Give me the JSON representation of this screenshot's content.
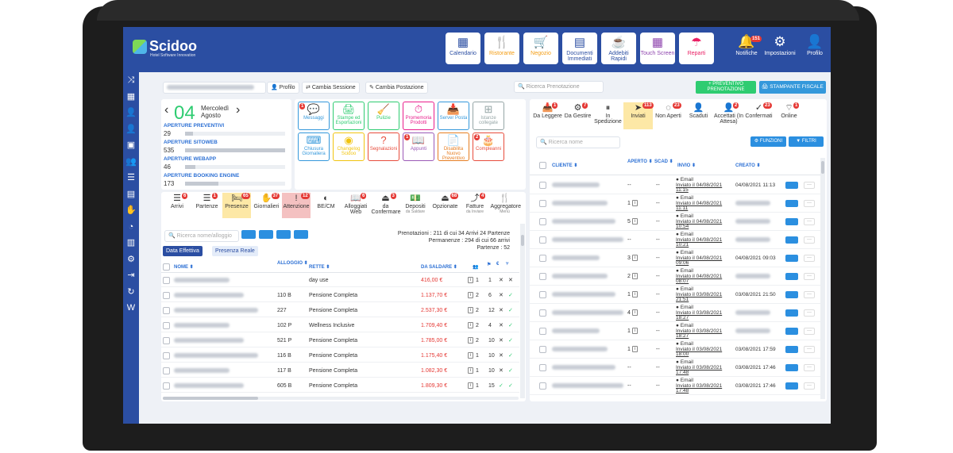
{
  "app": {
    "brand": "Scidoo",
    "tagline": "Hotel Software Innovation"
  },
  "topbar": {
    "tiles": [
      {
        "label": "Calendario",
        "icon": "calendar-icon",
        "color": "#2b4ea2"
      },
      {
        "label": "Ristorante",
        "icon": "fork-knife-icon",
        "color": "#f39c12"
      },
      {
        "label": "Negozio",
        "icon": "cart-icon",
        "color": "#f39c12"
      },
      {
        "label": "Documenti Immediati",
        "icon": "document-icon",
        "color": "#2b4ea2"
      },
      {
        "label": "Addebiti Rapidi",
        "icon": "coffee-cup-icon",
        "color": "#2b4ea2"
      },
      {
        "label": "Touch Screen",
        "icon": "calculator-icon",
        "color": "#8e44ad"
      },
      {
        "label": "Reparti",
        "icon": "umbrella-icon",
        "color": "#e91e63"
      }
    ],
    "notifications": {
      "label": "Notifiche",
      "count": "151"
    },
    "settings": {
      "label": "Impostazioni"
    },
    "profile": {
      "label": "Profilo"
    }
  },
  "subbar": {
    "profile_btn": "Profilo",
    "change_session": "Cambia Sessione",
    "change_station": "Cambia Postazione",
    "search_placeholder": "Ricerca Prenotazione",
    "preventivo": "+ PREVENTIVO PRENOTAZIONE",
    "stampante": "STAMPANTE FISCALE"
  },
  "date_panel": {
    "day": "04",
    "weekday": "Mercoledì",
    "month": "Agosto",
    "stats": [
      {
        "label": "APERTURE PREVENTIVI",
        "value": "29",
        "fill": 0.08
      },
      {
        "label": "APERTURE SITOWEB",
        "value": "535",
        "fill": 1.0
      },
      {
        "label": "APERTURE WEBAPP",
        "value": "46",
        "fill": 0.1
      },
      {
        "label": "APERTURE BOOKING ENGINE",
        "value": "173",
        "fill": 0.33
      }
    ]
  },
  "shortcuts": [
    {
      "label": "Messaggi",
      "icon": "chat-icon",
      "badge": "1",
      "color": "#3498db"
    },
    {
      "label": "Stampe ed Esportazioni",
      "icon": "printer-icon",
      "badge": "",
      "color": "#2ecc71"
    },
    {
      "label": "Pulizie",
      "icon": "broom-icon",
      "badge": "",
      "color": "#2ecc71"
    },
    {
      "label": "Promemoria Prodotti",
      "icon": "timer-icon",
      "badge": "",
      "color": "#e91e8c"
    },
    {
      "label": "Server Posta",
      "icon": "inbox-icon",
      "badge": "",
      "color": "#3498db"
    },
    {
      "label": "Istanze collegate",
      "icon": "network-icon",
      "badge": "",
      "color": "#95a5a6"
    },
    {
      "label": "Chiusura Giornaliera",
      "icon": "keyboard-icon",
      "badge": "",
      "color": "#3498db"
    },
    {
      "label": "Changelog Scidoo",
      "icon": "rss-icon",
      "badge": "",
      "color": "#f1c40f"
    },
    {
      "label": "Segnalazioni",
      "icon": "question-icon",
      "badge": "",
      "color": "#e74c3c"
    },
    {
      "label": "Appunti",
      "icon": "book-icon",
      "badge": "1",
      "color": "#9b59b6"
    },
    {
      "label": "Disabilita Nuovo Preventivo",
      "icon": "document-alert-icon",
      "badge": "",
      "color": "#e67e22"
    },
    {
      "label": "Compleanni",
      "icon": "cake-icon",
      "badge": "2",
      "color": "#e74c3c"
    }
  ],
  "left_tools": [
    {
      "label": "Arrivi",
      "icon": "list-icon",
      "badge": "6",
      "sub": ""
    },
    {
      "label": "Partenze",
      "icon": "list-icon",
      "badge": "1",
      "sub": ""
    },
    {
      "label": "Presenze",
      "icon": "bed-icon",
      "badge": "65",
      "sub": ""
    },
    {
      "label": "Giornalieri",
      "icon": "hands-icon",
      "badge": "37",
      "sub": ""
    },
    {
      "label": "Attenzione",
      "icon": "exclamation-icon",
      "badge": "12",
      "sub": ""
    },
    {
      "label": "BE/CM",
      "icon": "globe-icon",
      "badge": "",
      "sub": ""
    },
    {
      "label": "Alloggiati Web",
      "icon": "book-icon",
      "badge": "6",
      "sub": ""
    },
    {
      "label": "da Confermare",
      "icon": "eject-icon",
      "badge": "3",
      "sub": ""
    },
    {
      "label": "Depositi",
      "icon": "money-icon",
      "badge": "",
      "sub": "da Saldare"
    },
    {
      "label": "Opzionate",
      "icon": "eject-icon",
      "badge": "68",
      "sub": ""
    },
    {
      "label": "Fatture",
      "icon": "share-icon",
      "badge": "4",
      "sub": "da Inviare"
    },
    {
      "label": "Aggregatore",
      "icon": "fork-knife-icon",
      "badge": "",
      "sub": "Menù"
    }
  ],
  "presenze": {
    "search_placeholder": "Ricerca nome/alloggio",
    "tab_active": "Data Effettiva",
    "tab_other": "Presenza Reale",
    "summary_line1": "Prenotazioni : 211 di cui 34 Arrivi 24 Partenze",
    "summary_line2": "Permanenze : 294 di cui 66 arrivi",
    "summary_line3": "Partenze : 52",
    "columns": {
      "nome": "NOME",
      "alloggio": "ALLOGGIO",
      "rette": "RETTE",
      "saldare": "DA SALDARE"
    },
    "rows": [
      {
        "alloggio": "",
        "rette": "day use",
        "saldo": "416,00 €",
        "n1": "1",
        "n2": "1",
        "m1": "✕",
        "m2": "✕"
      },
      {
        "alloggio": "110 B",
        "rette": "Pensione Completa",
        "saldo": "1.137,70 €",
        "n1": "2",
        "n2": "6",
        "m1": "✕",
        "m2": "✓"
      },
      {
        "alloggio": "227",
        "rette": "Pensione Completa",
        "saldo": "2.537,30 €",
        "n1": "2",
        "n2": "12",
        "m1": "✕",
        "m2": "✓"
      },
      {
        "alloggio": "102 P",
        "rette": "Wellness Inclusive",
        "saldo": "1.709,40 €",
        "n1": "2",
        "n2": "4",
        "m1": "✕",
        "m2": "✓"
      },
      {
        "alloggio": "521 P",
        "rette": "Pensione Completa",
        "saldo": "1.785,00 €",
        "n1": "2",
        "n2": "10",
        "m1": "✕",
        "m2": "✓"
      },
      {
        "alloggio": "116 B",
        "rette": "Pensione Completa",
        "saldo": "1.175,40 €",
        "n1": "1",
        "n2": "10",
        "m1": "✕",
        "m2": "✓"
      },
      {
        "alloggio": "117 B",
        "rette": "Pensione Completa",
        "saldo": "1.082,30 €",
        "n1": "1",
        "n2": "10",
        "m1": "✕",
        "m2": "✓"
      },
      {
        "alloggio": "605 B",
        "rette": "Pensione Completa",
        "saldo": "1.809,30 €",
        "n1": "1",
        "n2": "15",
        "m1": "✓",
        "m2": "✓"
      }
    ]
  },
  "right_tools": [
    {
      "label": "Da Leggere",
      "icon": "inbox-icon",
      "badge": "1"
    },
    {
      "label": "Da Gestire",
      "icon": "gear-icon",
      "badge": "7"
    },
    {
      "label": "In Spedizione",
      "icon": "pause-icon",
      "badge": ""
    },
    {
      "label": "Inviati",
      "icon": "send-icon",
      "badge": "113"
    },
    {
      "label": "Non Aperti",
      "icon": "eye-off-icon",
      "badge": "23"
    },
    {
      "label": "Scaduti",
      "icon": "user-x-icon",
      "badge": ""
    },
    {
      "label": "Accettati (In Attesa)",
      "icon": "user-check-icon",
      "badge": "2"
    },
    {
      "label": "Confermati",
      "icon": "check-icon",
      "badge": "23"
    },
    {
      "label": "Online",
      "icon": "wifi-icon",
      "badge": "1"
    }
  ],
  "preventivi": {
    "search_placeholder": "Ricerca nome",
    "funzioni": "FUNZIONI",
    "filtri": "FILTRI",
    "columns": {
      "cliente": "CLIENTE",
      "aperto": "APERTO",
      "scad": "SCAD",
      "invio": "INVIO",
      "creato": "CREATO"
    },
    "rows": [
      {
        "aperto": "--",
        "scad": "--",
        "invio_type": "Email",
        "invio": "Inviato il 04/08/2021 11:15",
        "creato": "04/08/2021 11:13"
      },
      {
        "aperto": "1",
        "scad": "--",
        "invio_type": "Email",
        "invio": "Inviato il 04/08/2021 11:11",
        "creato": ""
      },
      {
        "aperto": "5",
        "scad": "--",
        "invio_type": "Email",
        "invio": "Inviato il 04/08/2021 10:54",
        "creato": ""
      },
      {
        "aperto": "--",
        "scad": "--",
        "invio_type": "Email",
        "invio": "Inviato il 04/08/2021 10:21",
        "creato": ""
      },
      {
        "aperto": "3",
        "scad": "--",
        "invio_type": "Email",
        "invio": "Inviato il 04/08/2021 09:06",
        "creato": "04/08/2021 09:03"
      },
      {
        "aperto": "2",
        "scad": "--",
        "invio_type": "Email",
        "invio": "Inviato il 04/08/2021 08:07",
        "creato": ""
      },
      {
        "aperto": "1",
        "scad": "--",
        "invio_type": "Email",
        "invio": "Inviato il 03/08/2021 21:51",
        "creato": "03/08/2021 21:50"
      },
      {
        "aperto": "4",
        "scad": "--",
        "invio_type": "Email",
        "invio": "Inviato il 03/08/2021 18:27",
        "creato": ""
      },
      {
        "aperto": "1",
        "scad": "--",
        "invio_type": "Email",
        "invio": "Inviato il 03/08/2021 18:27",
        "creato": ""
      },
      {
        "aperto": "1",
        "scad": "--",
        "invio_type": "Email",
        "invio": "Inviato il 03/08/2021 18:00",
        "creato": "03/08/2021 17:59"
      },
      {
        "aperto": "--",
        "scad": "--",
        "invio_type": "Email",
        "invio": "Inviato il 03/08/2021 17:48",
        "creato": "03/08/2021 17:46"
      },
      {
        "aperto": "--",
        "scad": "--",
        "invio_type": "Email",
        "invio": "Inviato il 03/08/2021 17:48",
        "creato": "03/08/2021 17:46"
      }
    ]
  }
}
